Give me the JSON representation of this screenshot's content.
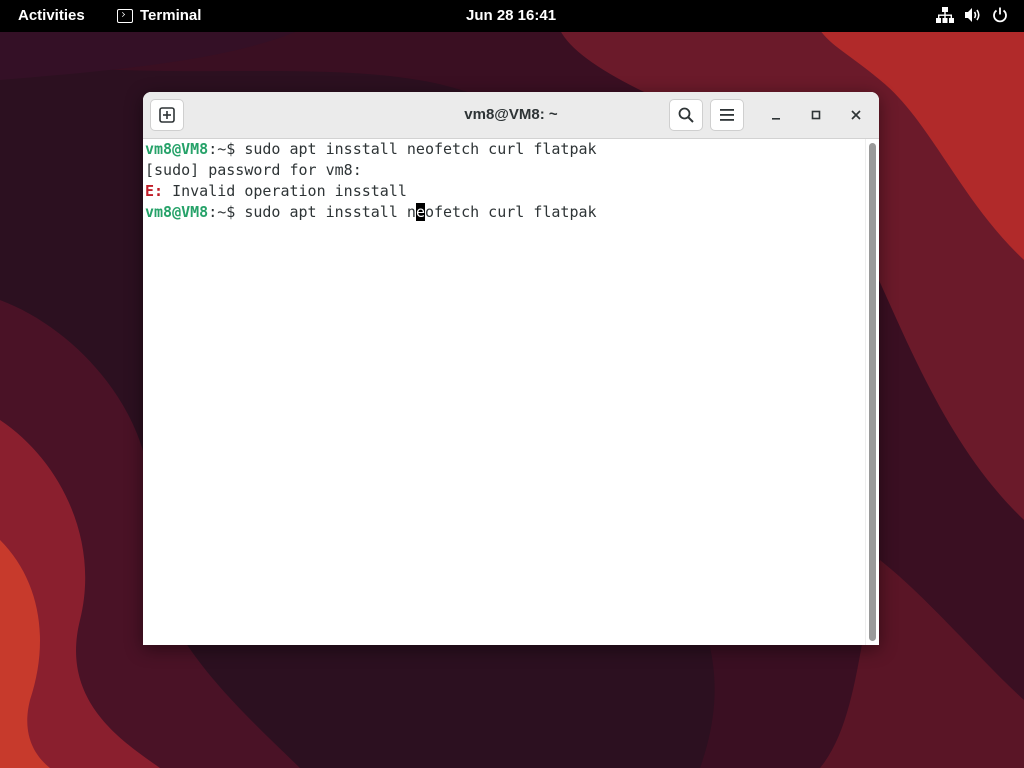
{
  "topbar": {
    "activities": "Activities",
    "app_name": "Terminal",
    "clock": "Jun 28  16:41"
  },
  "window": {
    "title": "vm8@VM8: ~"
  },
  "terminal": {
    "lines": [
      {
        "user": "vm8@VM8",
        "path": ":~$",
        "cmd": " sudo apt insstall neofetch curl flatpak"
      },
      {
        "text": "[sudo] password for vm8:"
      },
      {
        "err_prefix": "E:",
        "text": " Invalid operation insstall"
      },
      {
        "user": "vm8@VM8",
        "path": ":~$",
        "cmd_before_cursor": " sudo apt insstall n",
        "cursor_char": "e",
        "cmd_after_cursor": "ofetch curl flatpak"
      }
    ]
  },
  "colors": {
    "prompt_user": "#26a269",
    "error": "#c01c28",
    "topbar_bg": "#000000",
    "headerbar_bg": "#ebebeb"
  },
  "icons": {
    "new_tab": "new-tab-icon",
    "search": "search-icon",
    "menu": "hamburger-menu-icon",
    "minimize": "minimize-icon",
    "maximize": "maximize-icon",
    "close": "close-icon",
    "network": "network-icon",
    "volume": "volume-icon",
    "power": "power-icon"
  }
}
